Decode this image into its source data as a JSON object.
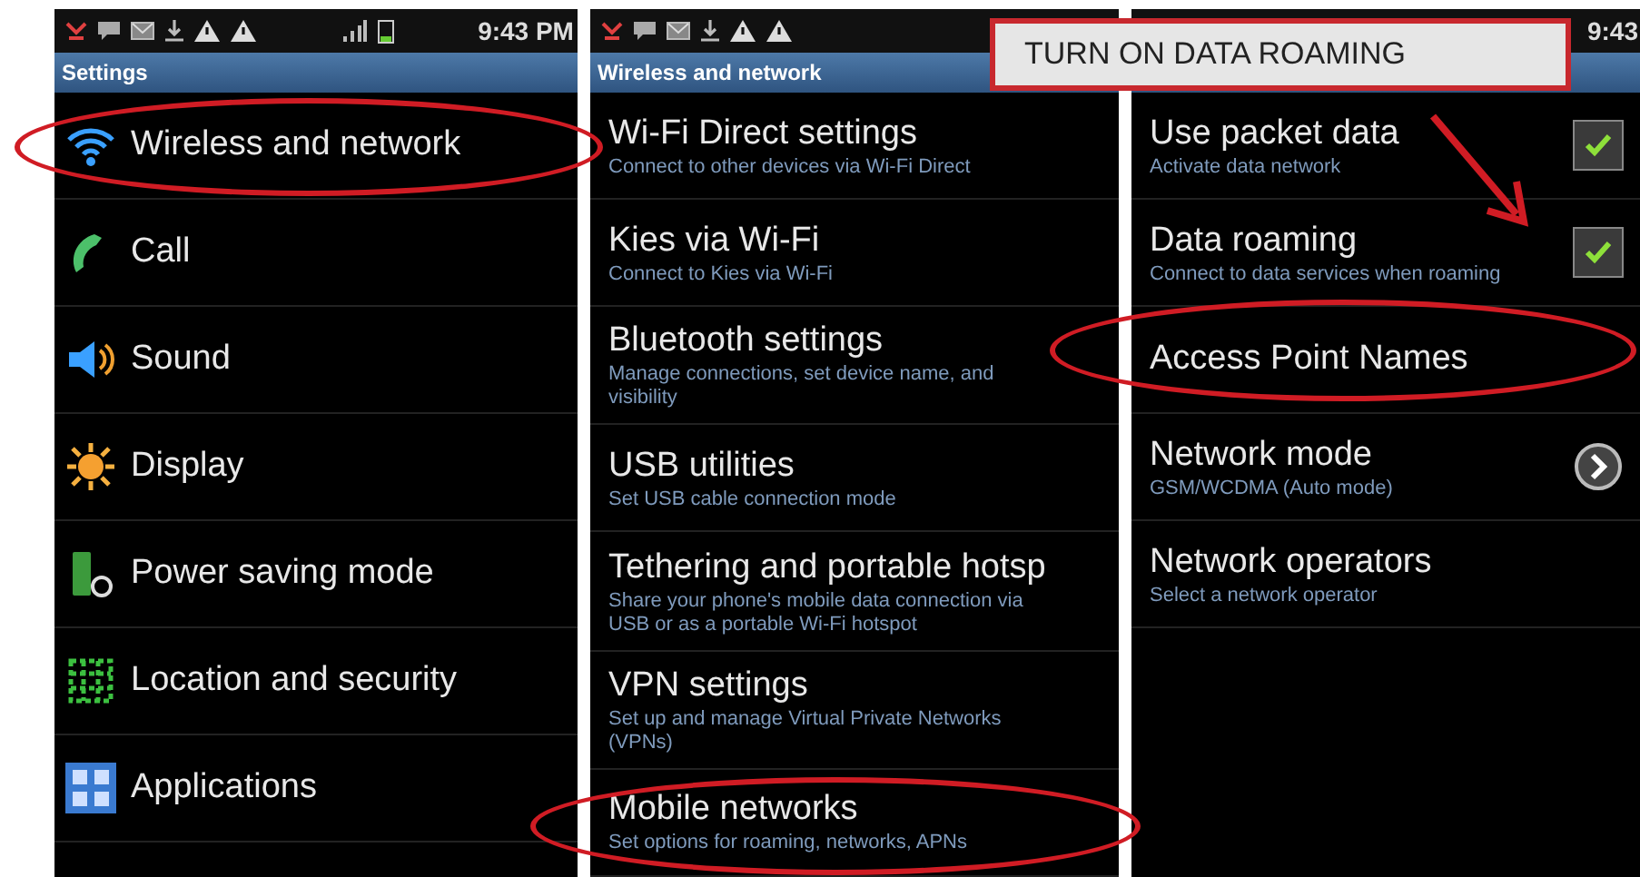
{
  "panels": [
    {
      "status_time": "9:43 PM",
      "title": "Settings",
      "items": [
        {
          "kind": "icon",
          "label": "Wireless and network",
          "circled": true
        },
        {
          "kind": "icon",
          "label": "Call",
          "circled": false
        },
        {
          "kind": "icon",
          "label": "Sound",
          "circled": false
        },
        {
          "kind": "icon",
          "label": "Display",
          "circled": false
        },
        {
          "kind": "icon",
          "label": "Power saving mode",
          "circled": false
        },
        {
          "kind": "icon",
          "label": "Location and security",
          "circled": false
        },
        {
          "kind": "icon",
          "label": "Applications",
          "circled": false
        }
      ]
    },
    {
      "title": "Wireless and network",
      "items": [
        {
          "kind": "plain",
          "label": "Wi-Fi Direct settings",
          "subtitle": "Connect to other devices via Wi-Fi Direct",
          "circled": false
        },
        {
          "kind": "plain",
          "label": "Kies via Wi-Fi",
          "subtitle": "Connect to Kies via Wi-Fi",
          "circled": false
        },
        {
          "kind": "plain",
          "label": "Bluetooth settings",
          "subtitle": "Manage connections, set device name, and visibility",
          "circled": false
        },
        {
          "kind": "plain",
          "label": "USB utilities",
          "subtitle": "Set USB cable connection mode",
          "circled": false
        },
        {
          "kind": "plain",
          "label": "Tethering and portable hotsp",
          "subtitle": "Share your phone's mobile data connection via USB or as a portable Wi-Fi hotspot",
          "circled": false
        },
        {
          "kind": "plain",
          "label": "VPN settings",
          "subtitle": "Set up and manage Virtual Private Networks (VPNs)",
          "circled": false
        },
        {
          "kind": "plain",
          "label": "Mobile networks",
          "subtitle": "Set options for roaming, networks, APNs",
          "circled": true
        }
      ]
    },
    {
      "status_time": "9:43",
      "items": [
        {
          "kind": "check",
          "label": "Use packet data",
          "subtitle": "Activate data network",
          "checked": true,
          "circled": false
        },
        {
          "kind": "check",
          "label": "Data roaming",
          "subtitle": "Connect to data services when roaming",
          "checked": true,
          "circled": false
        },
        {
          "kind": "plain",
          "label": "Access Point Names",
          "circled": true
        },
        {
          "kind": "chevron",
          "label": "Network mode",
          "subtitle": "GSM/WCDMA (Auto mode)",
          "circled": false
        },
        {
          "kind": "plain",
          "label": "Network operators",
          "subtitle": "Select a network operator",
          "circled": false
        }
      ]
    }
  ],
  "callout": {
    "text": "TURN ON DATA ROAMING"
  }
}
